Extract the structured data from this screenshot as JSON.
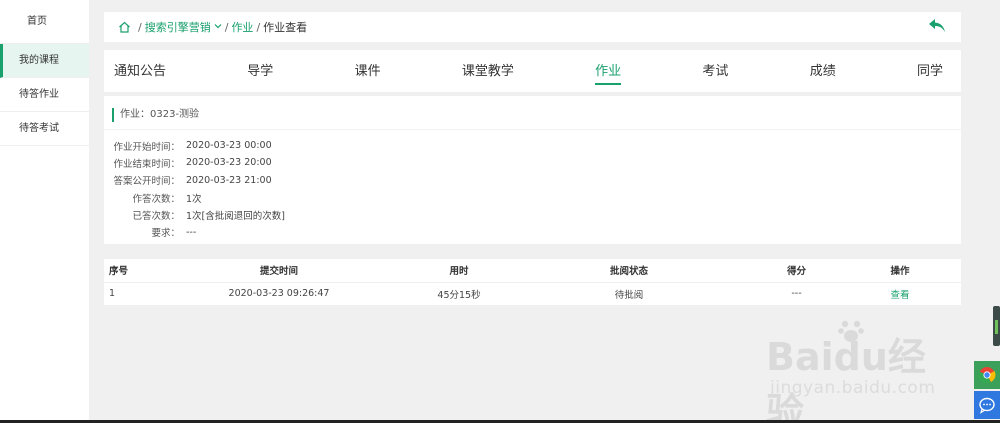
{
  "sidebar": {
    "items": [
      {
        "label": "首页"
      },
      {
        "label": "我的课程"
      },
      {
        "label": "待答作业"
      },
      {
        "label": "待答考试"
      }
    ]
  },
  "breadcrumb": {
    "course": "搜索引擎营销",
    "section": "作业",
    "current": "作业查看",
    "sep": "/"
  },
  "tabs": [
    {
      "label": "通知公告"
    },
    {
      "label": "导学"
    },
    {
      "label": "课件"
    },
    {
      "label": "课堂教学"
    },
    {
      "label": "作业"
    },
    {
      "label": "考试"
    },
    {
      "label": "成绩"
    },
    {
      "label": "同学"
    }
  ],
  "assignment": {
    "title": "作业：0323-测验",
    "rows": [
      {
        "label": "作业开始时间：",
        "value": "2020-03-23 00:00"
      },
      {
        "label": "作业结束时间：",
        "value": "2020-03-23 20:00"
      },
      {
        "label": "答案公开时间：",
        "value": "2020-03-23 21:00"
      },
      {
        "label": "作答次数：",
        "value": "1次"
      },
      {
        "label": "已答次数：",
        "value": "1次[含批阅退回的次数]"
      },
      {
        "label": "要求：",
        "value": "---"
      }
    ]
  },
  "table": {
    "headers": [
      "序号",
      "提交时间",
      "用时",
      "批阅状态",
      "得分",
      "操作"
    ],
    "rows": [
      {
        "index": "1",
        "submitted": "2020-03-23 09:26:47",
        "duration": "45分15秒",
        "status": "待批阅",
        "score": "---",
        "action": "查看"
      }
    ]
  },
  "watermark": {
    "main": "Baidu经验",
    "sub": "jingyan.baidu.com"
  },
  "colors": {
    "accent": "#1aa06d"
  }
}
